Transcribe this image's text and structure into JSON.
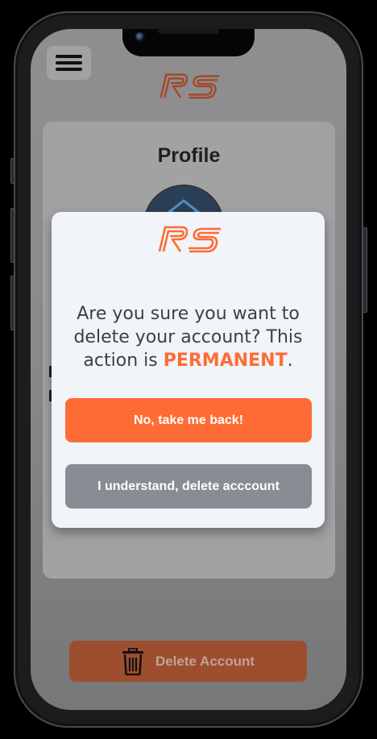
{
  "app": {
    "logo_text": "RS",
    "accent": "#ff6b35"
  },
  "profile": {
    "title": "Profile"
  },
  "footer": {
    "delete_label": "Delete Account"
  },
  "modal": {
    "message_before": "Are you sure you want to delete your account? This action is ",
    "message_emphasis": "PERMANENT",
    "message_after": ".",
    "cancel_label": "No, take me back!",
    "confirm_label": "I understand, delete acccount"
  },
  "icons": [
    "hamburger-menu-icon",
    "trash-icon",
    "camera-icon"
  ]
}
